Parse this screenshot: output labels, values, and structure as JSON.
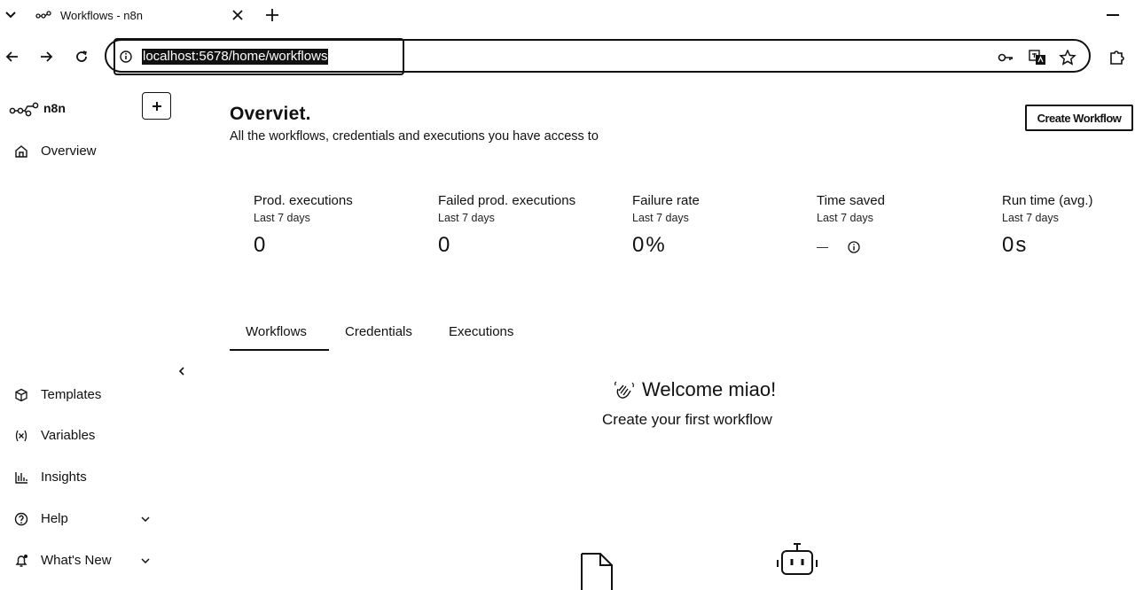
{
  "browser": {
    "tab": {
      "title": "Workflows - n8n"
    },
    "address_bar": {
      "url": "localhost:5678/home/workflows"
    }
  },
  "sidebar": {
    "logo_text": "n8n",
    "overview_label": "Overview",
    "items": [
      {
        "label": "Templates",
        "icon": "box-icon"
      },
      {
        "label": "Variables",
        "icon": "variable-icon"
      },
      {
        "label": "Insights",
        "icon": "bar-chart-icon"
      },
      {
        "label": "Help",
        "icon": "help-icon"
      },
      {
        "label": "What's New",
        "icon": "bell-icon"
      }
    ]
  },
  "main": {
    "title": "Overviet.",
    "subtitle": "All the workflows, credentials and executions you have access to",
    "create_button": "Create Workflow",
    "stats": [
      {
        "title": "Prod. executions",
        "period": "Last 7 days",
        "value": "0"
      },
      {
        "title": "Failed prod. executions",
        "period": "Last 7 days",
        "value": "0"
      },
      {
        "title": "Failure rate",
        "period": "Last 7 days",
        "value": "0%"
      },
      {
        "title": "Time saved",
        "period": "Last 7 days",
        "value": "—"
      },
      {
        "title": "Run time (avg.)",
        "period": "Last 7 days",
        "value": "0s"
      }
    ],
    "tabs": [
      "Workflows",
      "Credentials",
      "Executions"
    ],
    "active_tab": "Workflows",
    "welcome": "Welcome miao!",
    "welcome_sub": "Create your first workflow"
  }
}
